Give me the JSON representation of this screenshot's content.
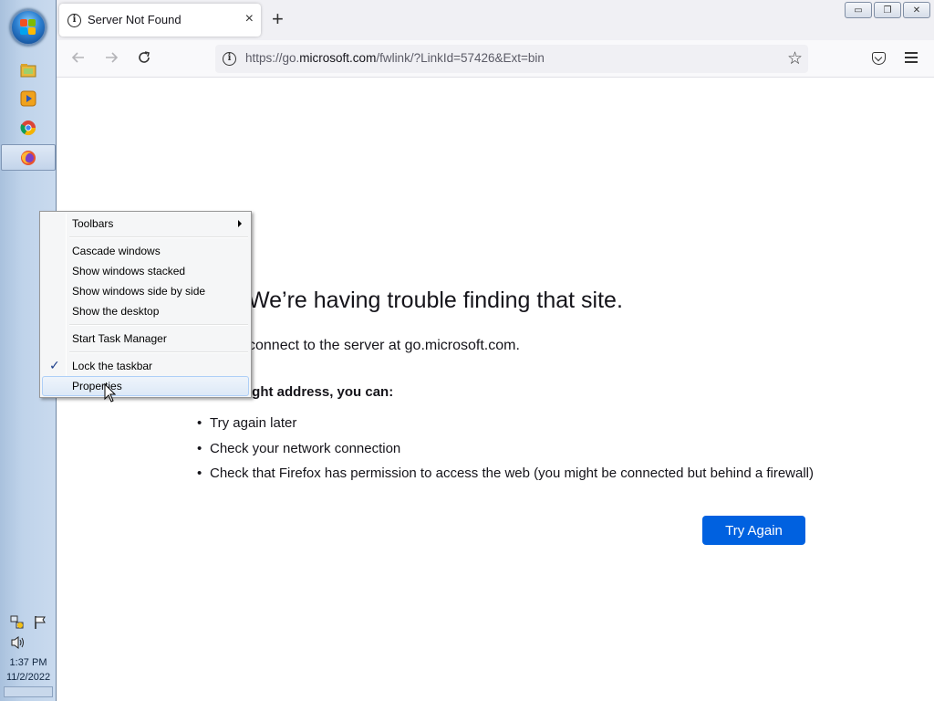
{
  "taskbar": {
    "start_button": "start-button",
    "pinned": [
      {
        "name": "file-explorer-icon",
        "color": "#e7b93c"
      },
      {
        "name": "media-player-icon",
        "color": "#f0a21c"
      },
      {
        "name": "chrome-icon",
        "color": "#2f9e44"
      },
      {
        "name": "firefox-icon",
        "color": "#e8542c"
      }
    ],
    "clock_time": "1:37 PM",
    "clock_date": "11/2/2022"
  },
  "browser": {
    "tab_title": "Server Not Found",
    "tab_close": "×",
    "new_tab": "+",
    "url_prefix": "https://go.",
    "url_domain": "microsoft.com",
    "url_suffix": "/fwlink/?LinkId=57426&Ext=bin",
    "window_buttons": {
      "minimize": "▭",
      "restore": "❐",
      "close": "✕"
    }
  },
  "error_page": {
    "title": "We’re having trouble finding that site.",
    "description": "connect to the server at go.microsoft.com.",
    "subheading": "red the right address, you can:",
    "suggestions": [
      "Try again later",
      "Check your network connection",
      "Check that Firefox has permission to access the web (you might be connected but behind a firewall)"
    ],
    "button_label": "Try Again",
    "accent_color": "#0061e0"
  },
  "context_menu": {
    "items": {
      "toolbars": "Toolbars",
      "cascade": "Cascade windows",
      "stacked": "Show windows stacked",
      "side_by_side": "Show windows side by side",
      "show_desktop": "Show the desktop",
      "task_manager": "Start Task Manager",
      "lock_taskbar": "Lock the taskbar",
      "properties": "Properties"
    },
    "lock_checked": true,
    "hovered_item": "Properties"
  }
}
